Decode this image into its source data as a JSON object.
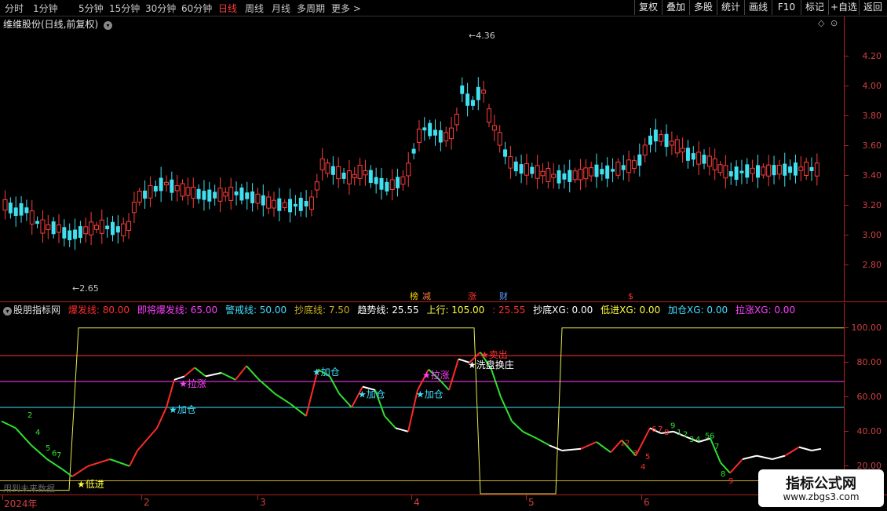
{
  "periods": [
    "分时",
    "1分钟",
    "5分钟",
    "15分钟",
    "30分钟",
    "60分钟",
    "日线",
    "周线",
    "月线",
    "多周期",
    "更多 >"
  ],
  "active_period": "日线",
  "toolbar": [
    "复权",
    "叠加",
    "多股",
    "统计",
    "画线",
    "F10",
    "标记",
    "+自选",
    "返回"
  ],
  "stock_title": "维维股份(日线,前复权)",
  "price_axis": [
    "4.20",
    "4.00",
    "3.80",
    "3.60",
    "3.40",
    "3.20",
    "3.00",
    "2.80"
  ],
  "high_label": "4.36",
  "low_label": "2.65",
  "event_markers": [
    {
      "text": "榜",
      "color": "#ffd700"
    },
    {
      "text": "减",
      "color": "#ff8040"
    },
    {
      "text": "涨",
      "color": "#ff3030"
    },
    {
      "text": "财",
      "color": "#60a0ff"
    },
    {
      "text": "$",
      "color": "#ff3030"
    }
  ],
  "indicator": {
    "name": "股朋指标网",
    "items": [
      {
        "label": "爆发线: 80.00",
        "color": "#ff3030"
      },
      {
        "label": "即将爆发线: 65.00",
        "color": "#ff40ff"
      },
      {
        "label": "警戒线: 50.00",
        "color": "#40e0ff"
      },
      {
        "label": "抄底线: 7.50",
        "color": "#c8b020"
      },
      {
        "label": "趋势线: 25.55",
        "color": "#ffffff"
      },
      {
        "label": "上行: 105.00",
        "color": "#ffff40"
      },
      {
        "label": ": 25.55",
        "color": "#ff3030"
      },
      {
        "label": "抄底XG: 0.00",
        "color": "#ffffff"
      },
      {
        "label": "低进XG: 0.00",
        "color": "#ffff40"
      },
      {
        "label": "加仓XG: 0.00",
        "color": "#40e0ff"
      },
      {
        "label": "拉涨XG: 0.00",
        "color": "#ff40ff"
      }
    ]
  },
  "sub_axis": [
    "100.00",
    "80.00",
    "60.00",
    "40.00",
    "20.00"
  ],
  "signals": [
    {
      "text": "低进",
      "color": "#ffff40"
    },
    {
      "text": "加仓",
      "color": "#40e0ff"
    },
    {
      "text": "拉涨",
      "color": "#ff40ff"
    },
    {
      "text": "加仓",
      "color": "#40e0ff"
    },
    {
      "text": "加仓",
      "color": "#40e0ff"
    },
    {
      "text": "加仓",
      "color": "#40e0ff"
    },
    {
      "text": "拉涨",
      "color": "#ff40ff"
    },
    {
      "text": "卖出",
      "color": "#ff3030"
    },
    {
      "text": "洗盘换庄",
      "color": "#ffffff"
    }
  ],
  "x_labels": [
    "2024年",
    "2",
    "3",
    "4",
    "5",
    "6"
  ],
  "future_label": "用到未来数据",
  "watermark": {
    "title": "指标公式网",
    "url": "www.zbgs3.com"
  }
}
